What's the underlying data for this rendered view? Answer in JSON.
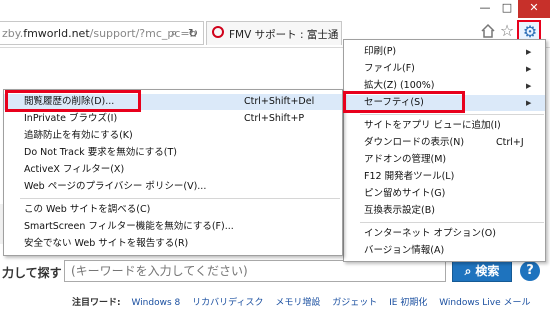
{
  "window": {
    "minimize_glyph": "—",
    "maximize_glyph": "□",
    "close_glyph": "✕"
  },
  "address_bar": {
    "url_prefix": "zby.",
    "url_domain": "fmworld.net",
    "url_suffix": "/support/?mc_pc=n"
  },
  "tab": {
    "title": "FMV サポート : 富士通",
    "close_glyph": "×"
  },
  "toolbar_icons": {
    "home": "home-icon",
    "favorites": "star-icon",
    "tools": "gear-icon"
  },
  "tools_menu": {
    "items": [
      {
        "label": "印刷(P)",
        "has_submenu": true
      },
      {
        "label": "ファイル(F)",
        "has_submenu": true
      },
      {
        "label": "拡大(Z) (100%)",
        "has_submenu": true
      },
      {
        "label": "セーフティ(S)",
        "has_submenu": true,
        "highlighted": true
      },
      {
        "label": "サイトをアプリ ビューに追加(I)"
      },
      {
        "label": "ダウンロードの表示(N)",
        "shortcut": "Ctrl+J"
      },
      {
        "label": "アドオンの管理(M)"
      },
      {
        "label": "F12 開発者ツール(L)"
      },
      {
        "label": "ピン留めサイト(G)"
      },
      {
        "label": "互換表示設定(B)"
      },
      {
        "label": "インターネット オプション(O)"
      },
      {
        "label": "バージョン情報(A)"
      }
    ]
  },
  "safety_menu": {
    "items": [
      {
        "label": "閲覧履歴の削除(D)...",
        "shortcut": "Ctrl+Shift+Del",
        "highlighted": true
      },
      {
        "label": "InPrivate ブラウズ(I)",
        "shortcut": "Ctrl+Shift+P"
      },
      {
        "label": "追跡防止を有効にする(K)"
      },
      {
        "label": "Do Not Track 要求を無効にする(T)"
      },
      {
        "label": "ActiveX フィルター(X)"
      },
      {
        "label": "Web ページのプライバシー ポリシー(V)..."
      },
      {
        "label": "この Web サイトを調べる(C)"
      },
      {
        "label": "SmartScreen フィルター機能を無効にする(F)..."
      },
      {
        "label": "安全でない Web サイトを報告する(R)"
      }
    ]
  },
  "search": {
    "label": "力して探す",
    "placeholder": "(キーワードを入力してください)",
    "button_label": "検索",
    "help_glyph": "?"
  },
  "keywords": {
    "label": "注目ワード:",
    "links": [
      "Windows 8",
      "リカバリディスク",
      "メモリ増設",
      "ガジェット",
      "IE 初期化",
      "Windows Live メール"
    ]
  },
  "colors": {
    "highlight_border": "#e8001c",
    "accent_blue": "#1e73be",
    "link_blue": "#1a4fa0"
  }
}
